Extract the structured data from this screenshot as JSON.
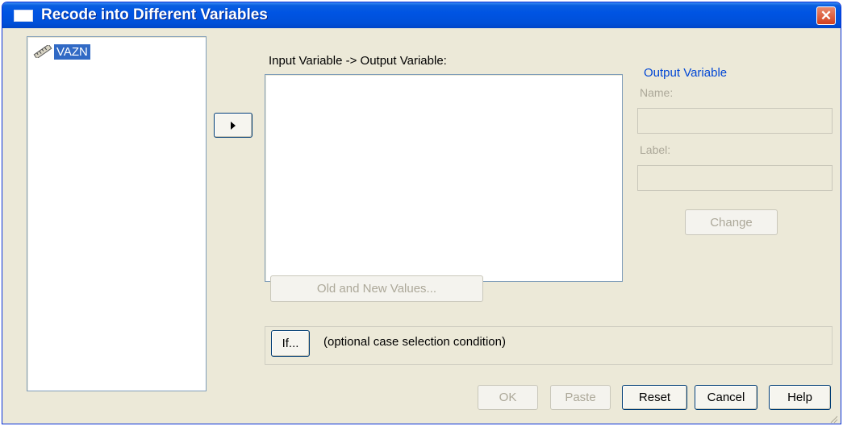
{
  "window": {
    "title": "Recode into Different Variables",
    "close_symbol": "✕"
  },
  "source_list": {
    "items": [
      {
        "label": "VAZN",
        "icon": "ruler-icon",
        "selected": true
      }
    ]
  },
  "move_button": {
    "icon": "right-triangle-icon"
  },
  "io_section": {
    "label": "Input Variable -> Output Variable:",
    "items": []
  },
  "output_variable": {
    "group_title": "Output Variable",
    "name_label": "Name:",
    "name_value": "",
    "label_label": "Label:",
    "label_value": "",
    "change_label": "Change"
  },
  "old_new_values_label": "Old and New Values...",
  "if_section": {
    "button_label": "If...",
    "description": "(optional case selection condition)"
  },
  "footer_buttons": {
    "ok": "OK",
    "paste": "Paste",
    "reset": "Reset",
    "cancel": "Cancel",
    "help": "Help"
  },
  "colors": {
    "title_bar": "#0054e3",
    "dialog_bg": "#ece9d8",
    "selection": "#316ac5",
    "group_title": "#0046d5",
    "close_button": "#d2401e"
  }
}
